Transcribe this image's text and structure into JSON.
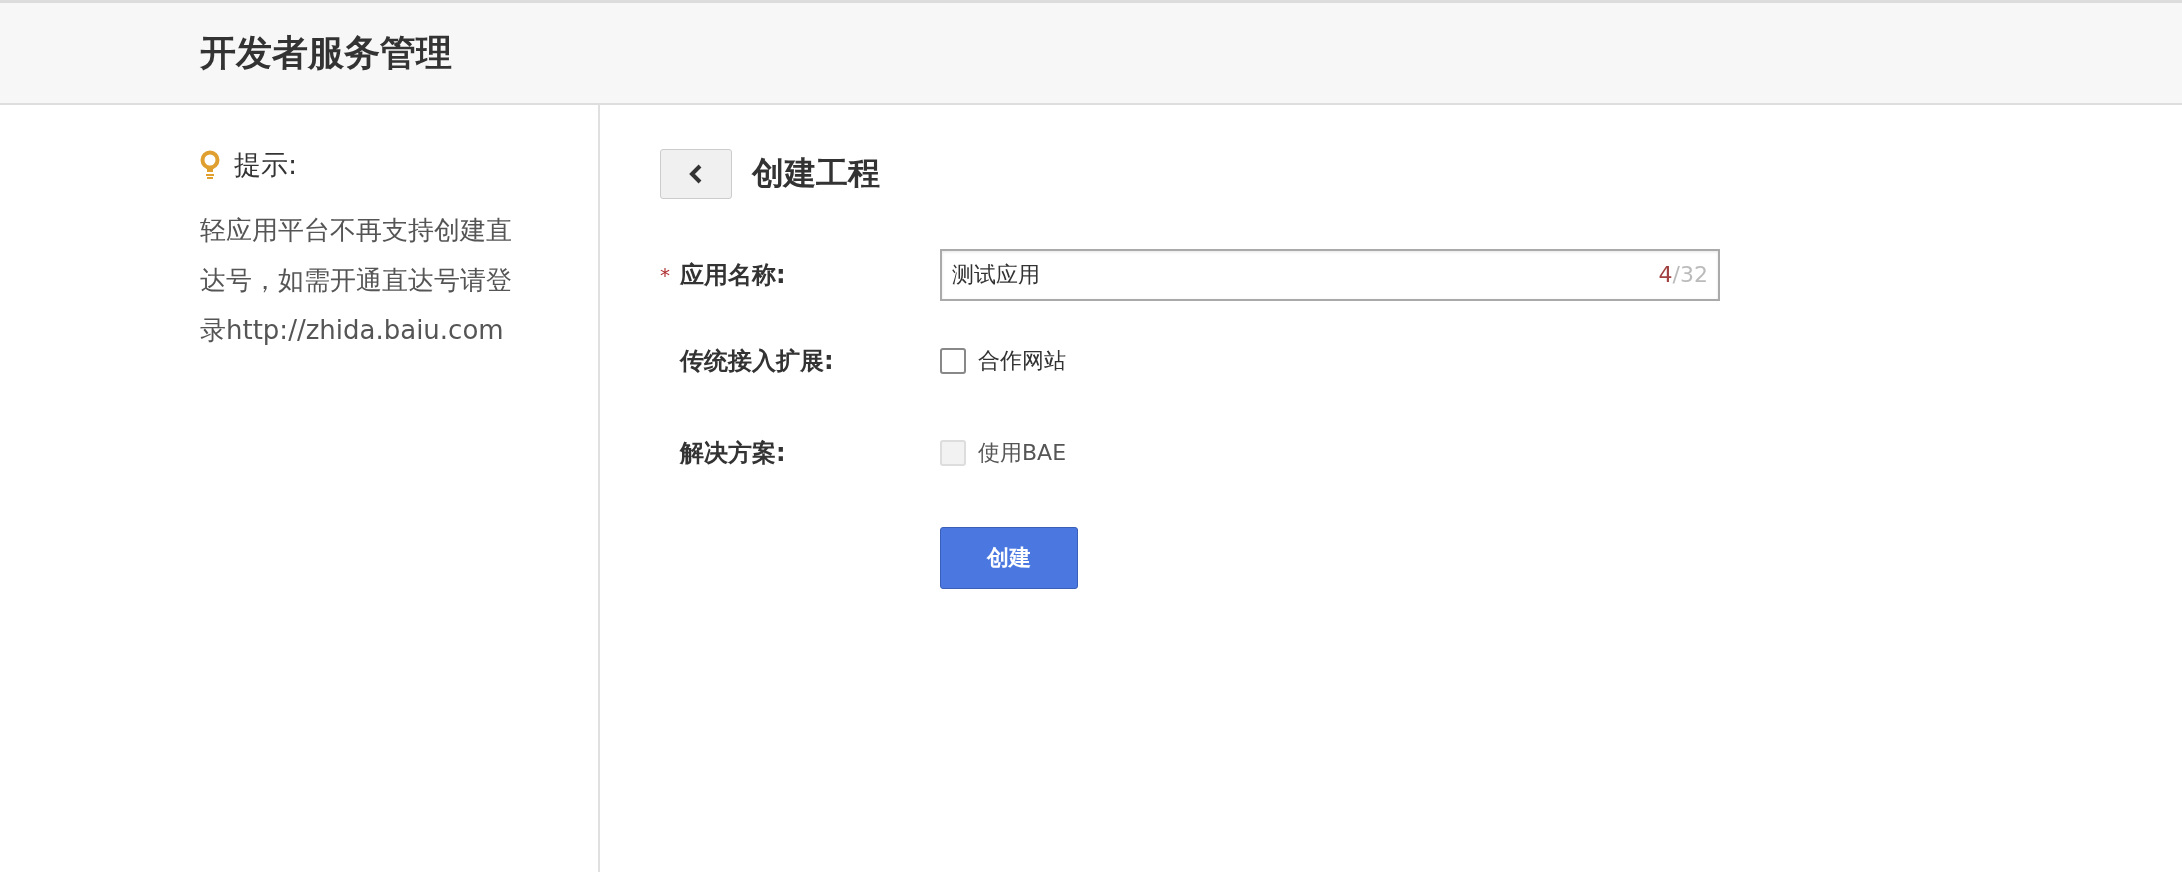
{
  "header": {
    "title": "开发者服务管理"
  },
  "sidebar": {
    "tip_title": "提示:",
    "tip_text": "轻应用平台不再支持创建直达号，如需开通直达号请登录http://zhida.baiu.com"
  },
  "main": {
    "title": "创建工程",
    "fields": [
      {
        "kind": "text",
        "required": true,
        "label": "应用名称:",
        "value": "测试应用",
        "count": "4",
        "limit": "/32"
      },
      {
        "kind": "checkbox",
        "required": false,
        "label": "传统接入扩展:",
        "option": "合作网站",
        "checked": false,
        "disabled": false
      },
      {
        "kind": "checkbox",
        "required": false,
        "label": "解决方案:",
        "option": "使用BAE",
        "checked": false,
        "disabled": true
      }
    ],
    "required_mark": "*",
    "submit": "创建"
  }
}
